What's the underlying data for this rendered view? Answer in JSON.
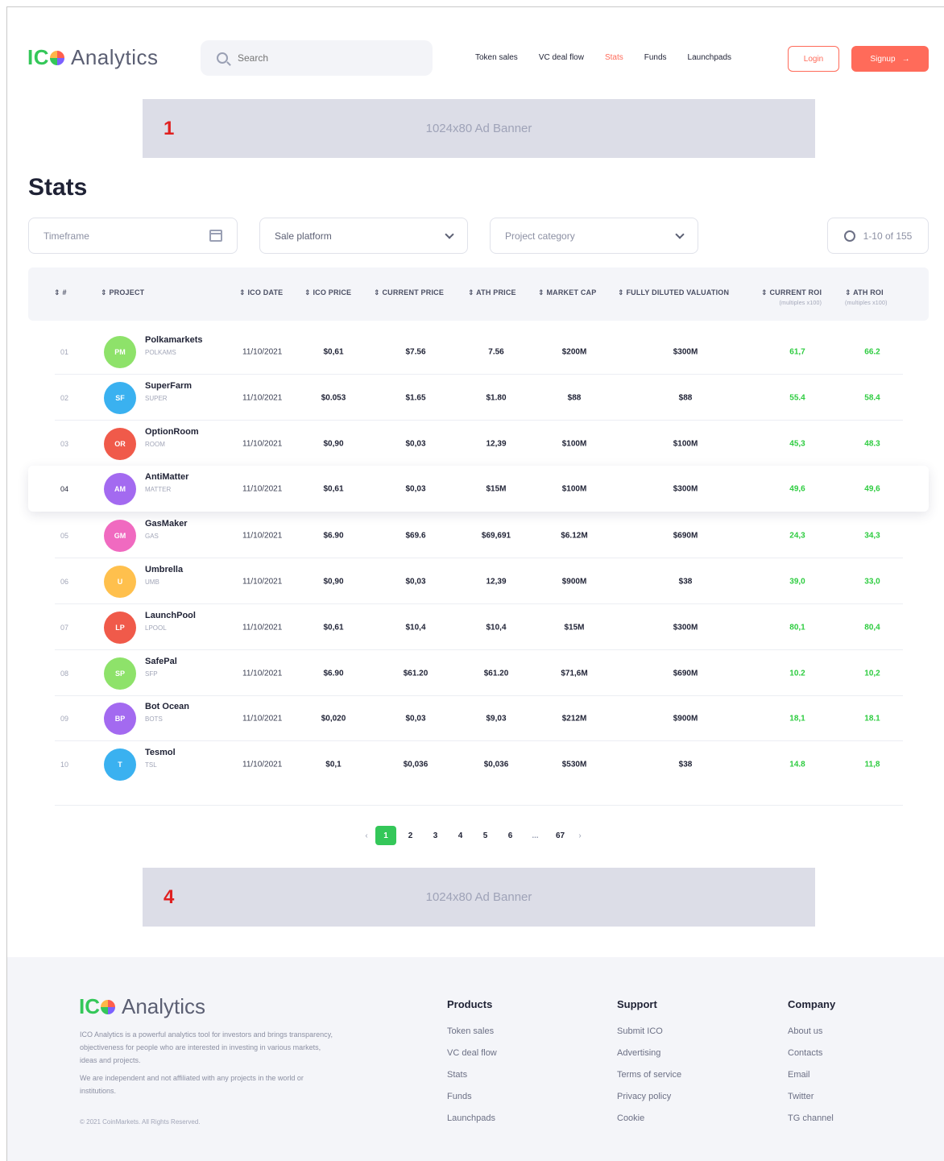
{
  "header": {
    "logo_ic": "IC",
    "logo_word": "Analytics",
    "search_placeholder": "Search",
    "nav": [
      "Token sales",
      "VC deal flow",
      "Stats",
      "Funds",
      "Launchpads"
    ],
    "nav_active": "Stats",
    "login_label": "Login",
    "signup_label": "Signup",
    "signup_arrow": "→"
  },
  "banners": [
    {
      "marker": "1",
      "label": "1024x80 Ad Banner"
    },
    {
      "marker": "4",
      "label": "1024x80 Ad Banner"
    }
  ],
  "page_title": "Stats",
  "filters": {
    "timeframe": "Timeframe",
    "sale_platform": "Sale platform",
    "project_category": "Project category",
    "range": "1-10 of 155"
  },
  "table": {
    "headers": [
      {
        "label": "⇕ #"
      },
      {
        "label": "⇕ PROJECT"
      },
      {
        "label": "⇕ ICO DATE"
      },
      {
        "label": "⇕ ICO PRICE"
      },
      {
        "label": "⇕ CURRENT PRICE"
      },
      {
        "label": "⇕ ATH PRICE"
      },
      {
        "label": "⇕ MARKET CAP"
      },
      {
        "label": "⇕ FULLY DILUTED VALUATION"
      },
      {
        "label": "⇕ CURRENT ROI",
        "sub": "(multiples x100)"
      },
      {
        "label": "⇕ ATH ROI",
        "sub": "(multiples x100)"
      }
    ],
    "rows": [
      {
        "idx": "01",
        "initials": "PM",
        "color": "#8ee26a",
        "name": "Polkamarkets",
        "ticker": "POLKAMS",
        "date": "11/10/2021",
        "ico": "$0,61",
        "current": "$7.56",
        "ath": "7.56",
        "mcap": "$200M",
        "fdv": "$300M",
        "croi": "61,7",
        "aroi": "66.2"
      },
      {
        "idx": "02",
        "initials": "SF",
        "color": "#3ab1f0",
        "name": "SuperFarm",
        "ticker": "SUPER",
        "date": "11/10/2021",
        "ico": "$0.053",
        "current": "$1.65",
        "ath": "$1.80",
        "mcap": "$88",
        "fdv": "$88",
        "croi": "55.4",
        "aroi": "58.4"
      },
      {
        "idx": "03",
        "initials": "OR",
        "color": "#f05a4a",
        "name": "OptionRoom",
        "ticker": "ROOM",
        "date": "11/10/2021",
        "ico": "$0,90",
        "current": "$0,03",
        "ath": "12,39",
        "mcap": "$100M",
        "fdv": "$100M",
        "croi": "45,3",
        "aroi": "48.3"
      },
      {
        "idx": "04",
        "initials": "AM",
        "color": "#a36af0",
        "name": "AntiMatter",
        "ticker": "MATTER",
        "date": "11/10/2021",
        "ico": "$0,61",
        "current": "$0,03",
        "ath": "$15M",
        "mcap": "$100M",
        "fdv": "$300M",
        "croi": "49,6",
        "aroi": "49,6"
      },
      {
        "idx": "05",
        "initials": "GM",
        "color": "#f06ac0",
        "name": "GasMaker",
        "ticker": "GAS",
        "date": "11/10/2021",
        "ico": "$6.90",
        "current": "$69.6",
        "ath": "$69,691",
        "mcap": "$6.12M",
        "fdv": "$690M",
        "croi": "24,3",
        "aroi": "34,3"
      },
      {
        "idx": "06",
        "initials": "U",
        "color": "#ffc04d",
        "name": "Umbrella",
        "ticker": "UMB",
        "date": "11/10/2021",
        "ico": "$0,90",
        "current": "$0,03",
        "ath": "12,39",
        "mcap": "$900M",
        "fdv": "$38",
        "croi": "39,0",
        "aroi": "33,0"
      },
      {
        "idx": "07",
        "initials": "LP",
        "color": "#f05a4a",
        "name": "LaunchPool",
        "ticker": "LPOOL",
        "date": "11/10/2021",
        "ico": "$0,61",
        "current": "$10,4",
        "ath": "$10,4",
        "mcap": "$15M",
        "fdv": "$300M",
        "croi": "80,1",
        "aroi": "80,4"
      },
      {
        "idx": "08",
        "initials": "SP",
        "color": "#8ee26a",
        "name": "SafePal",
        "ticker": "SFP",
        "date": "11/10/2021",
        "ico": "$6.90",
        "current": "$61.20",
        "ath": "$61.20",
        "mcap": "$71,6M",
        "fdv": "$690M",
        "croi": "10.2",
        "aroi": "10,2"
      },
      {
        "idx": "09",
        "initials": "BP",
        "color": "#a36af0",
        "name": "Bot Ocean",
        "ticker": "BOTS",
        "date": "11/10/2021",
        "ico": "$0,020",
        "current": "$0,03",
        "ath": "$9,03",
        "mcap": "$212M",
        "fdv": "$900M",
        "croi": "18,1",
        "aroi": "18.1"
      },
      {
        "idx": "10",
        "initials": "T",
        "color": "#3ab1f0",
        "name": "Tesmol",
        "ticker": "TSL",
        "date": "11/10/2021",
        "ico": "$0,1",
        "current": "$0,036",
        "ath": "$0,036",
        "mcap": "$530M",
        "fdv": "$38",
        "croi": "14.8",
        "aroi": "11,8"
      }
    ]
  },
  "pagination": {
    "prev": "‹",
    "pages": [
      "1",
      "2",
      "3",
      "4",
      "5",
      "6",
      "...",
      "67"
    ],
    "current": "1",
    "next": "›"
  },
  "footer": {
    "logo_ic": "IC",
    "logo_word": "Analytics",
    "desc1": "ICO Analytics is a powerful analytics tool for investors and brings transparency, objectiveness for people who are interested in investing in various markets, ideas and projects.",
    "desc2": "We are independent and not affiliated with any projects in the world or institutions.",
    "copyright": "© 2021 CoinMarkets. All Rights Reserved.",
    "columns": [
      {
        "title": "Products",
        "links": [
          "Token sales",
          "VC deal flow",
          "Stats",
          "Funds",
          "Launchpads"
        ]
      },
      {
        "title": "Support",
        "links": [
          "Submit ICO",
          "Advertising",
          "Terms of service",
          "Privacy policy",
          "Cookie"
        ]
      },
      {
        "title": "Company",
        "links": [
          "About us",
          "Contacts",
          "Email",
          "Twitter",
          "TG channel"
        ]
      }
    ]
  }
}
